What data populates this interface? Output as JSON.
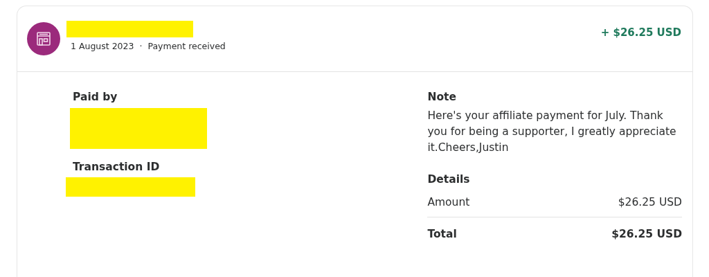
{
  "header": {
    "merchant_name": {
      "redacted": true
    },
    "date": "1 August 2023",
    "separator": "·",
    "status": "Payment received",
    "amount": "+ $26.25 USD"
  },
  "paid_by": {
    "label": "Paid by",
    "value": {
      "redacted": true
    }
  },
  "transaction_id": {
    "label": "Transaction ID",
    "value": {
      "redacted": true
    }
  },
  "note": {
    "label": "Note",
    "text": "Here's your affiliate payment for July. Thank you for being a supporter, I greatly appreciate it.Cheers,Justin"
  },
  "details": {
    "label": "Details",
    "rows": [
      {
        "kind": "line",
        "label": "Amount",
        "value": "$26.25 USD"
      },
      {
        "kind": "total",
        "label": "Total",
        "value": "$26.25 USD"
      }
    ]
  }
}
